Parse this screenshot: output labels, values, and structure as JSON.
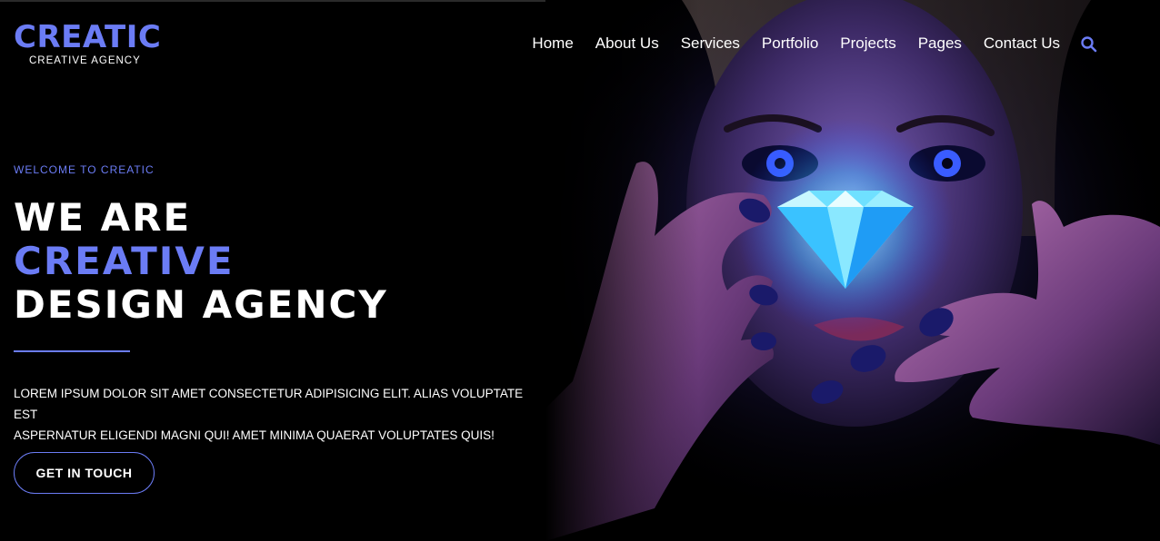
{
  "colors": {
    "accent": "#6b7cf5",
    "background": "#000000",
    "text": "#ffffff",
    "cta_border": "#6b7cf5"
  },
  "brand": {
    "name": "CREATIC",
    "tagline": "CREATIVE AGENCY"
  },
  "nav": {
    "items": [
      {
        "label": "Home"
      },
      {
        "label": "About Us"
      },
      {
        "label": "Services"
      },
      {
        "label": "Portfolio"
      },
      {
        "label": "Projects"
      },
      {
        "label": "Pages"
      },
      {
        "label": "Contact Us"
      }
    ],
    "search_icon": "search-icon"
  },
  "hero": {
    "eyebrow": "WELCOME TO CREATIC",
    "headline": {
      "line1": "WE ARE",
      "line2": "CREATIVE",
      "line3": "DESIGN AGENCY"
    },
    "body_line1": "LOREM IPSUM DOLOR SIT AMET CONSECTETUR ADIPISICING ELIT. ALIAS VOLUPTATE EST",
    "body_line2": "ASPERNATUR ELIGENDI MAGNI QUI! AMET MINIMA QUAERAT VOLUPTATES QUIS!",
    "cta_label": "GET IN TOUCH",
    "image_icon": "woman-holding-diamond-illustration"
  }
}
